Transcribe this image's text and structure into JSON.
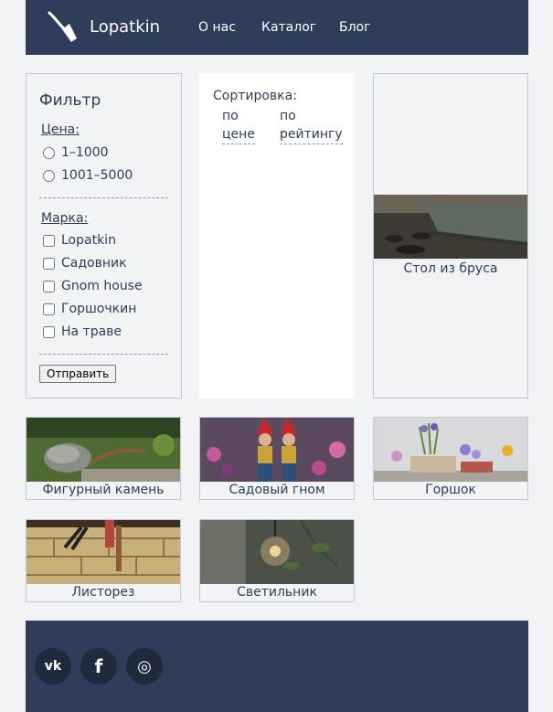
{
  "header": {
    "brand": "Lopatkin",
    "nav": [
      "О нас",
      "Каталог",
      "Блог"
    ]
  },
  "filter": {
    "title": "Фильтр",
    "price_label": "Цена:",
    "prices": [
      "1–1000",
      "1001–5000"
    ],
    "brand_label": "Марка:",
    "brands": [
      "Lopatkin",
      "Садовник",
      "Gnom house",
      "Горшочкин",
      "На траве"
    ],
    "submit": "Отправить"
  },
  "sort": {
    "title": "Сортировка:",
    "by_price": [
      "по",
      "цене"
    ],
    "by_rating": [
      "по",
      "рейтингу"
    ]
  },
  "products": [
    {
      "name": "Стол из бруса"
    },
    {
      "name": "Фигурный камень"
    },
    {
      "name": "Садовый гном"
    },
    {
      "name": "Горшок"
    },
    {
      "name": "Листорез"
    },
    {
      "name": "Светильник"
    }
  ],
  "footer": {
    "social": [
      {
        "icon": "vk-icon",
        "glyph": "vk"
      },
      {
        "icon": "facebook-icon",
        "glyph": "f"
      },
      {
        "icon": "instagram-icon",
        "glyph": "◎"
      }
    ]
  },
  "colors": {
    "header_bg": "#2f3d5b",
    "page_bg": "#f2f3f5"
  }
}
